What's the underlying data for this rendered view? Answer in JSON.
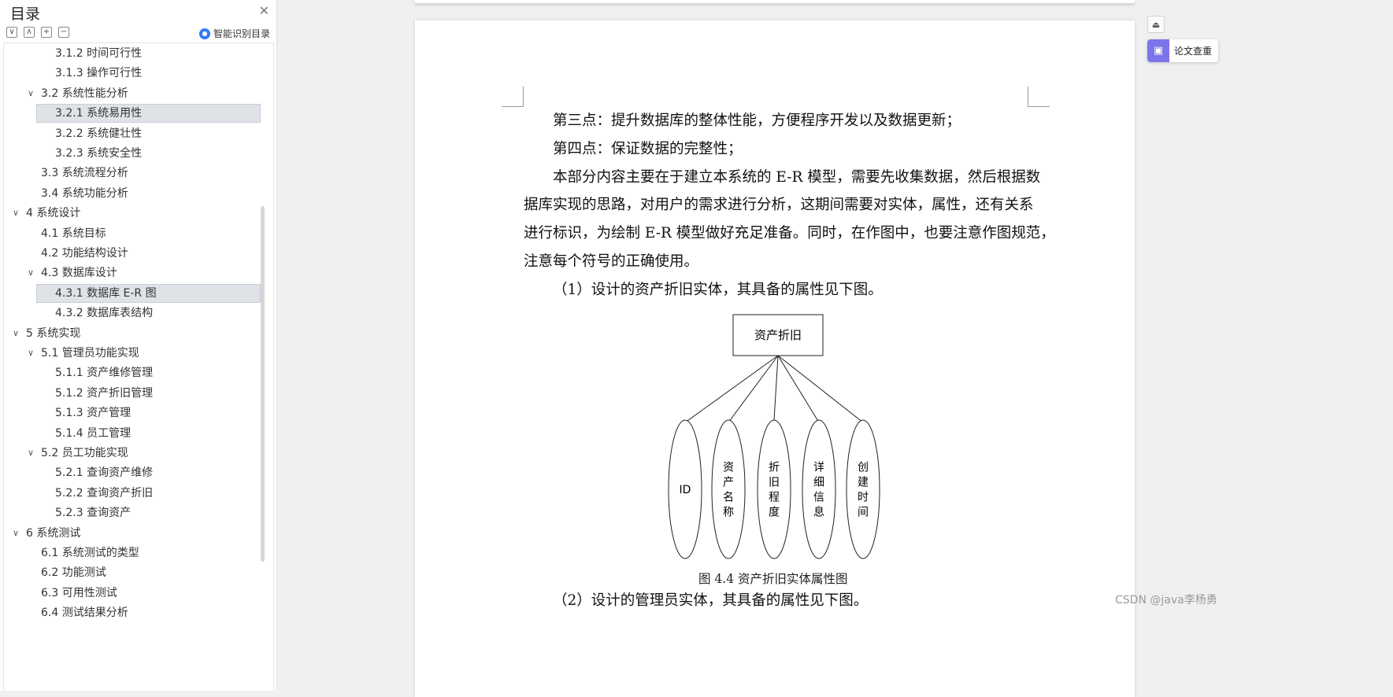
{
  "toc": {
    "title": "目录",
    "close_icon": "close-icon",
    "smart_toc_label": "智能识别目录",
    "tool_icons": [
      "collapse-all-icon",
      "expand-up-icon",
      "add-icon",
      "remove-icon"
    ],
    "items": [
      {
        "label": "3.1.2 时间可行性",
        "level": 3,
        "caret": ""
      },
      {
        "label": "3.1.3 操作可行性",
        "level": 3,
        "caret": ""
      },
      {
        "label": "3.2 系统性能分析",
        "level": 2,
        "caret": "∨"
      },
      {
        "label": "3.2.1 系统易用性",
        "level": 3,
        "caret": "",
        "selected": true
      },
      {
        "label": "3.2.2 系统健壮性",
        "level": 3,
        "caret": ""
      },
      {
        "label": "3.2.3 系统安全性",
        "level": 3,
        "caret": ""
      },
      {
        "label": "3.3  系统流程分析",
        "level": 2,
        "caret": ""
      },
      {
        "label": "3.4 系统功能分析",
        "level": 2,
        "caret": ""
      },
      {
        "label": "4  系统设计",
        "level": 1,
        "caret": "∨"
      },
      {
        "label": "4.1 系统目标",
        "level": 2,
        "caret": ""
      },
      {
        "label": "4.2 功能结构设计",
        "level": 2,
        "caret": ""
      },
      {
        "label": "4.3 数据库设计",
        "level": 2,
        "caret": "∨"
      },
      {
        "label": "4.3.1 数据库 E-R 图",
        "level": 3,
        "caret": "",
        "selected": true
      },
      {
        "label": "4.3.2  数据库表结构",
        "level": 3,
        "caret": ""
      },
      {
        "label": "5  系统实现",
        "level": 1,
        "caret": "∨"
      },
      {
        "label": "5.1  管理员功能实现",
        "level": 2,
        "caret": "∨"
      },
      {
        "label": "5.1.1  资产维修管理",
        "level": 3,
        "caret": ""
      },
      {
        "label": "5.1.2  资产折旧管理",
        "level": 3,
        "caret": ""
      },
      {
        "label": "5.1.3  资产管理",
        "level": 3,
        "caret": ""
      },
      {
        "label": "5.1.4  员工管理",
        "level": 3,
        "caret": ""
      },
      {
        "label": "5.2  员工功能实现",
        "level": 2,
        "caret": "∨"
      },
      {
        "label": "5.2.1  查询资产维修",
        "level": 3,
        "caret": ""
      },
      {
        "label": "5.2.2  查询资产折旧",
        "level": 3,
        "caret": ""
      },
      {
        "label": "5.2.3  查询资产",
        "level": 3,
        "caret": ""
      },
      {
        "label": "6 系统测试",
        "level": 1,
        "caret": "∨"
      },
      {
        "label": "6.1  系统测试的类型",
        "level": 2,
        "caret": ""
      },
      {
        "label": "6.2  功能测试",
        "level": 2,
        "caret": ""
      },
      {
        "label": "6.3  可用性测试",
        "level": 2,
        "caret": ""
      },
      {
        "label": "6.4  测试结果分析",
        "level": 2,
        "caret": ""
      }
    ]
  },
  "document": {
    "paragraphs": [
      "第三点：提升数据库的整体性能，方便程序开发以及数据更新；",
      "第四点：保证数据的完整性；",
      "本部分内容主要在于建立本系统的 E-R 模型，需要先收集数据，然后根据数",
      "据库实现的思路，对用户的需求进行分析，这期间需要对实体，属性，还有关系",
      "进行标识，为绘制 E-R 模型做好充足准备。同时，在作图中，也要注意作图规范，",
      "注意每个符号的正确使用。",
      "（1）设计的资产折旧实体，其具备的属性见下图。",
      "（2）设计的管理员实体，其具备的属性见下图。"
    ],
    "figure": {
      "entity": "资产折旧",
      "attributes": [
        "ID",
        "资产名称",
        "折旧程度",
        "详细信息",
        "创建时间"
      ],
      "caption": "图 4.4  资产折旧实体属性图"
    }
  },
  "right_tools": {
    "collapse_icon": "collapse-up-icon",
    "check_icon": "paper-check-icon",
    "check_label": "论文查重"
  },
  "watermark": "CSDN @java李杨勇"
}
